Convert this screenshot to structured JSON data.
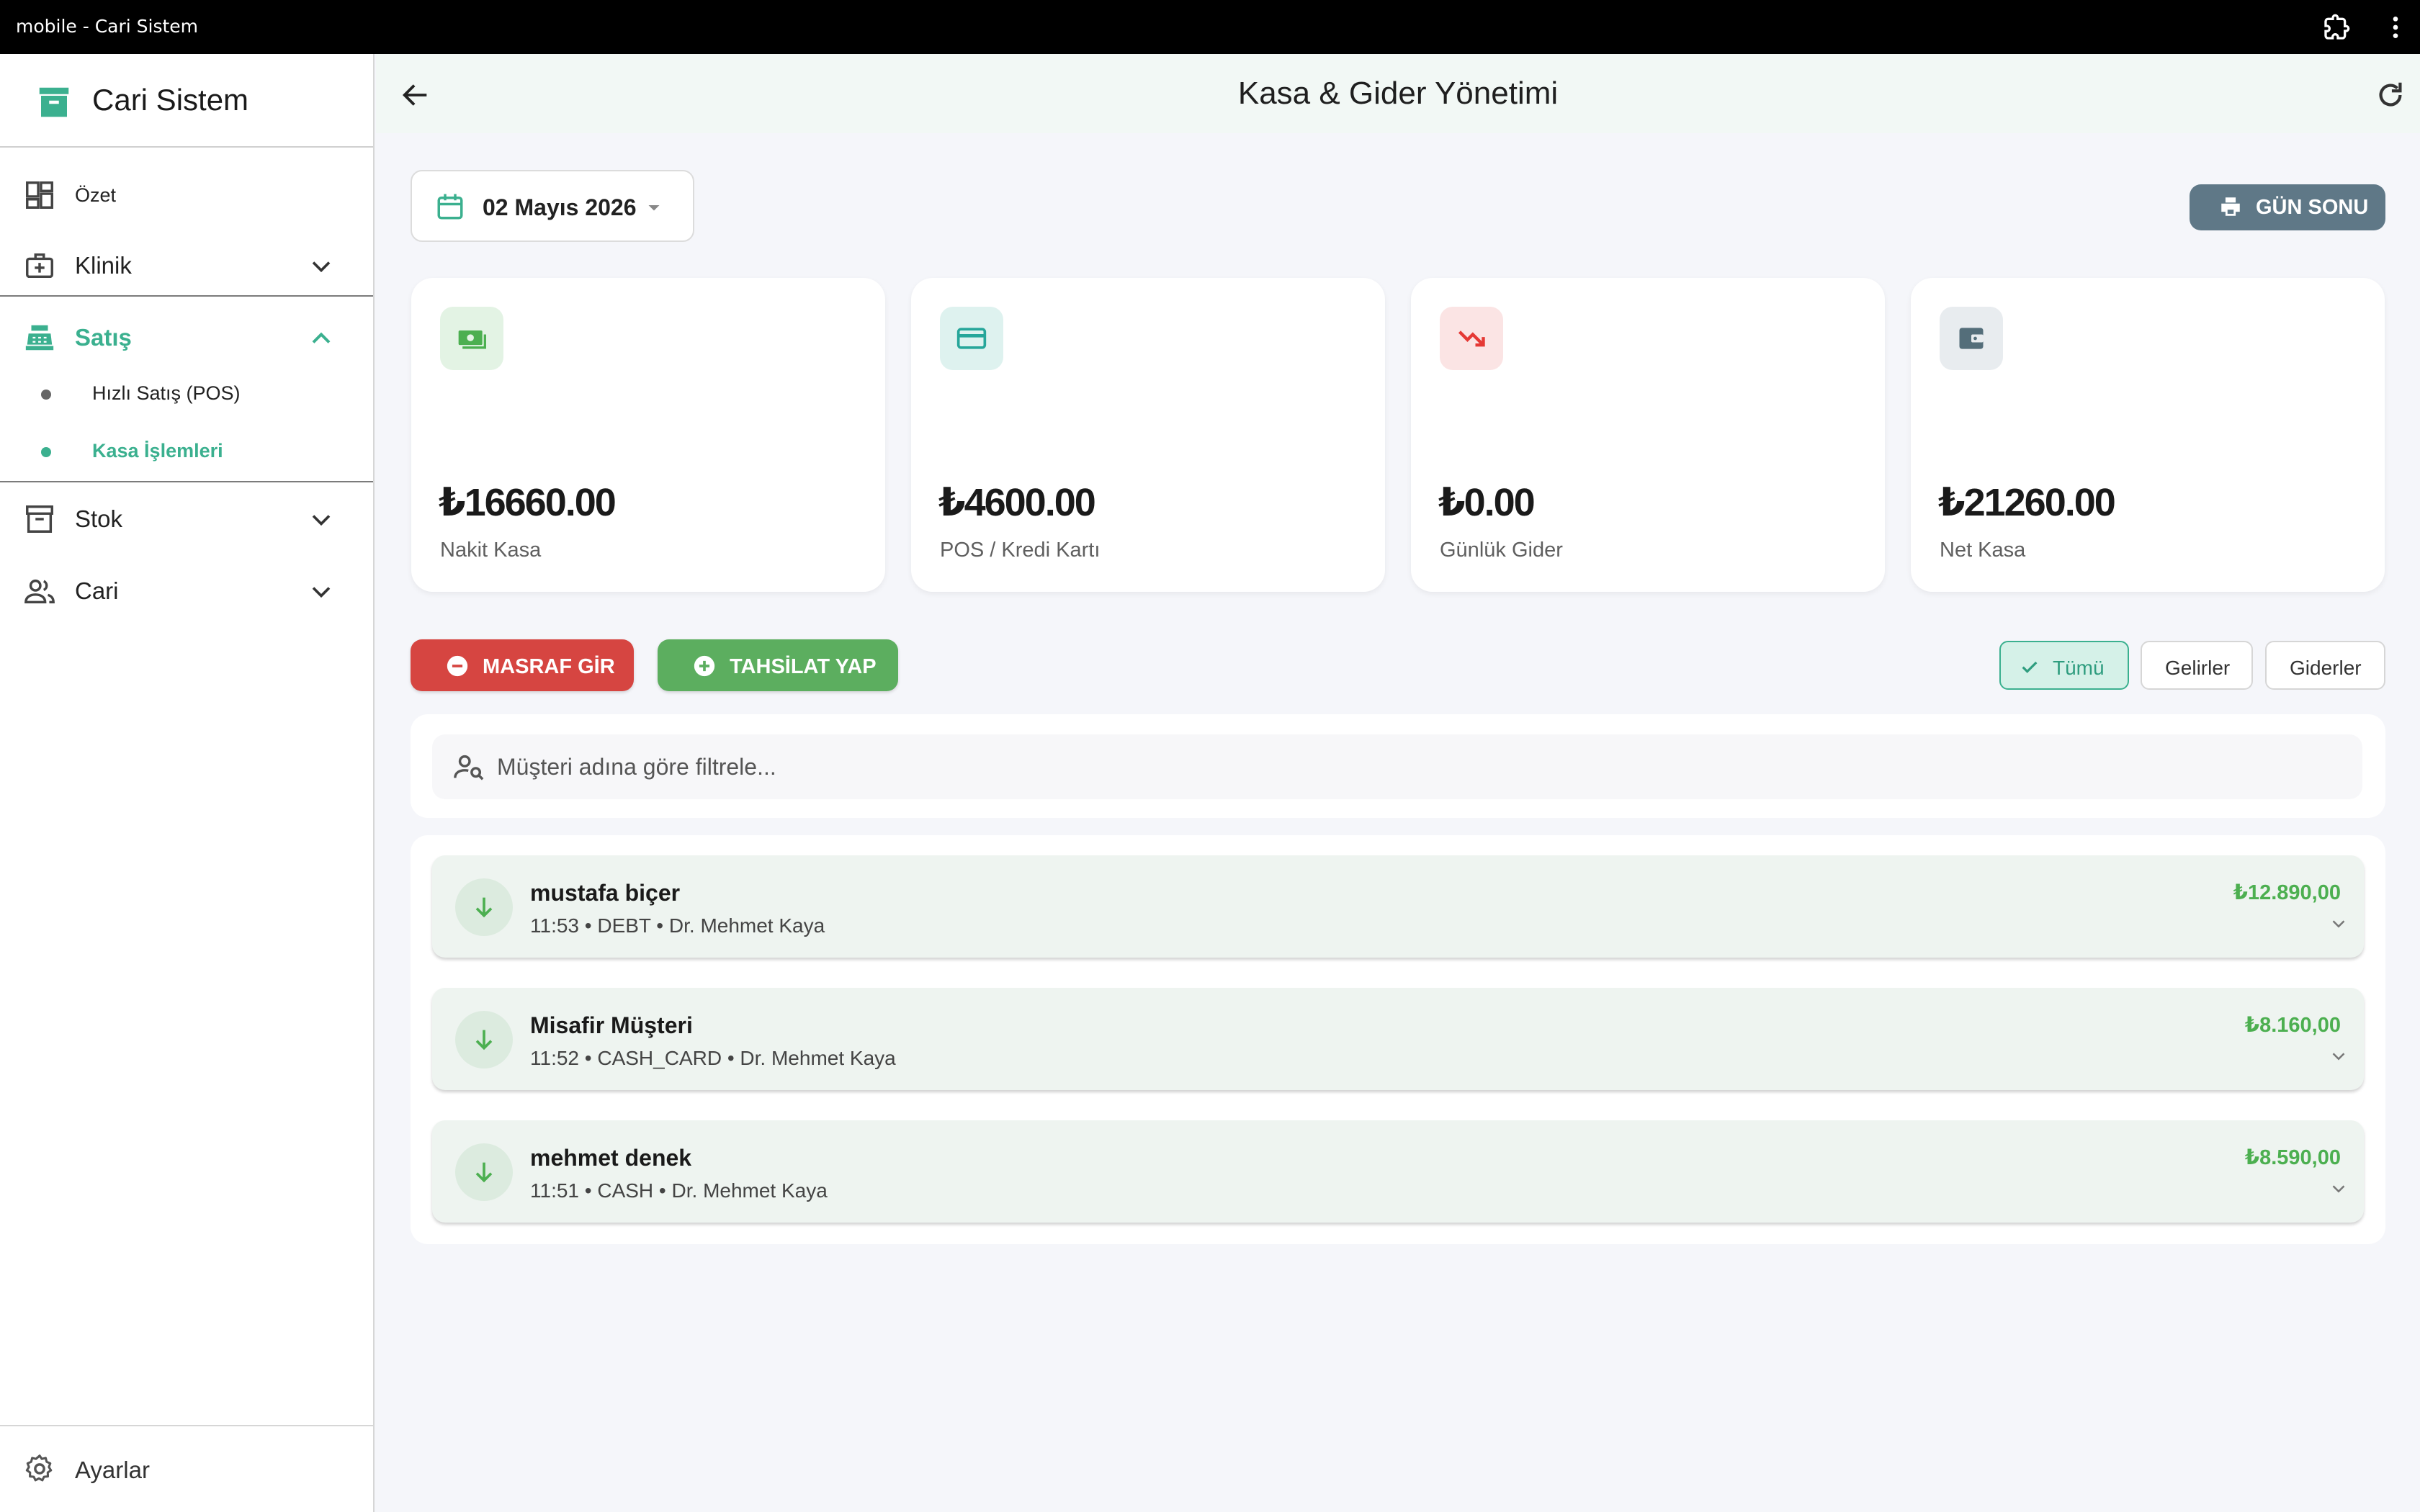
{
  "window": {
    "title": "mobile - Cari Sistem"
  },
  "sidebar": {
    "brand": "Cari Sistem",
    "items": [
      {
        "label": "Özet"
      },
      {
        "label": "Klinik"
      },
      {
        "label": "Satış"
      },
      {
        "label": "Stok"
      },
      {
        "label": "Cari"
      }
    ],
    "sales_sub": [
      {
        "label": "Hızlı Satış (POS)"
      },
      {
        "label": "Kasa İşlemleri"
      }
    ],
    "settings": "Ayarlar"
  },
  "header": {
    "title": "Kasa & Gider Yönetimi"
  },
  "date": {
    "label": "02 Mayıs 2026"
  },
  "actions": {
    "day_end": "GÜN SONU",
    "expense": "MASRAF GİR",
    "collect": "TAHSİLAT YAP"
  },
  "summary": [
    {
      "value": "₺16660.00",
      "label": "Nakit Kasa",
      "color": "#4caf50"
    },
    {
      "value": "₺4600.00",
      "label": "POS / Kredi Kartı",
      "color": "#26a69a"
    },
    {
      "value": "₺0.00",
      "label": "Günlük Gider",
      "color": "#e53935"
    },
    {
      "value": "₺21260.00",
      "label": "Net Kasa",
      "color": "#546e7a"
    }
  ],
  "filters": {
    "all": "Tümü",
    "income": "Gelirler",
    "expenses": "Giderler"
  },
  "search": {
    "placeholder": "Müşteri adına göre filtrele..."
  },
  "transactions": [
    {
      "name": "mustafa biçer",
      "meta": "11:53 • DEBT • Dr. Mehmet Kaya",
      "amount": "₺12.890,00"
    },
    {
      "name": "Misafir Müşteri",
      "meta": "11:52 • CASH_CARD • Dr. Mehmet Kaya",
      "amount": "₺8.160,00"
    },
    {
      "name": "mehmet denek",
      "meta": "11:51 • CASH • Dr. Mehmet Kaya",
      "amount": "₺8.590,00"
    }
  ],
  "colors": {
    "accent": "#3bb08f",
    "income": "#4caf50",
    "danger": "#d64541",
    "slate": "#5f7887"
  }
}
